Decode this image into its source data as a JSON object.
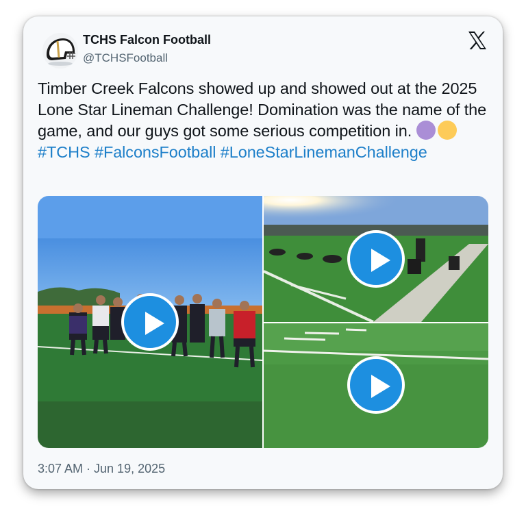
{
  "account": {
    "display_name": "TCHS Falcon Football",
    "handle": "@TCHSFootball",
    "avatar_icon": "football-helmet-icon"
  },
  "brand_icon": "x-logo-icon",
  "tweet": {
    "text": "Timber Creek Falcons showed up and showed out at the 2025 Lone Star Lineman Challenge! Domination was the name of the game, and our guys got some serious competition in.",
    "emojis": [
      "purple-circle",
      "yellow-circle"
    ],
    "hashtags": [
      "#TCHS",
      "#FalconsFootball",
      "#LoneStarLinemanChallenge"
    ],
    "hashtag_color": "#1d7fc9"
  },
  "media": {
    "videos": [
      {
        "label": "team-photo-video"
      },
      {
        "label": "drills-video"
      },
      {
        "label": "field-video"
      }
    ],
    "play_button_color": "#1d8fe0"
  },
  "timestamp": "3:07 AM · Jun 19, 2025"
}
